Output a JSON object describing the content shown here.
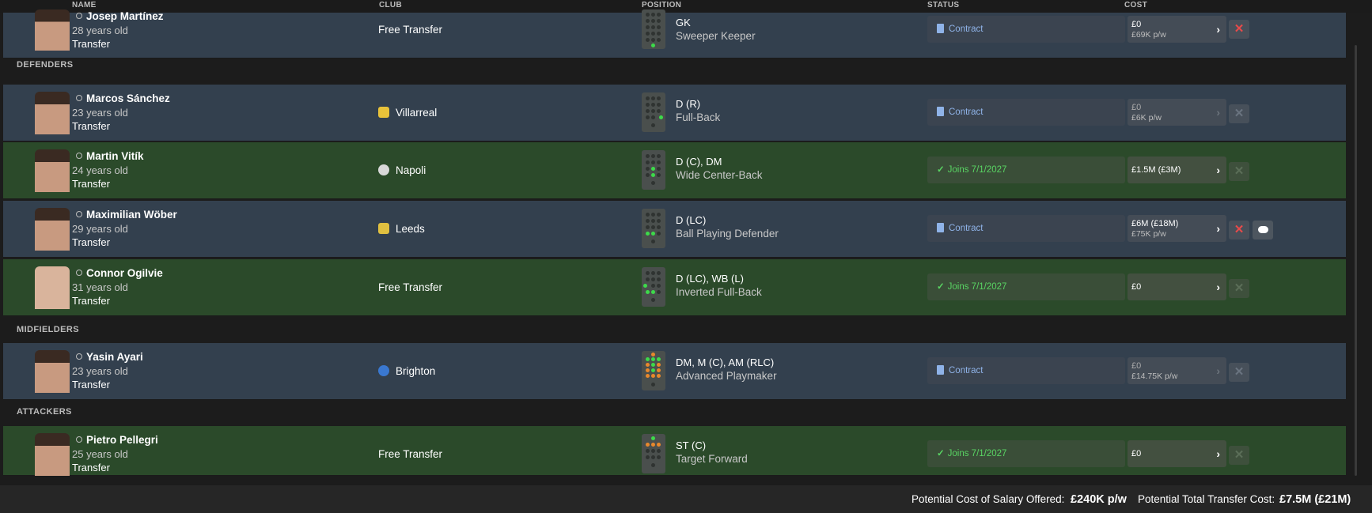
{
  "columns": {
    "name": "NAME",
    "club": "CLUB",
    "position": "POSITION",
    "status": "STATUS",
    "cost": "COST"
  },
  "sections": {
    "defenders": "DEFENDERS",
    "midfielders": "MIDFIELDERS",
    "attackers": "ATTACKERS"
  },
  "players": [
    {
      "name": "Josep Martínez",
      "age": "28 years old",
      "transfer": "Transfer",
      "club": "Free Transfer",
      "club_icon": "",
      "pos1": "GK",
      "pos2": "Sweeper Keeper",
      "status": "Contract",
      "status_type": "contract",
      "cost1": "£0",
      "cost2": "£69K p/w",
      "cancel_active": true,
      "chat": false
    },
    {
      "name": "Marcos Sánchez",
      "age": "23 years old",
      "transfer": "Transfer",
      "club": "Villarreal",
      "club_icon": "villarreal-badge-icon",
      "pos1": "D (R)",
      "pos2": "Full-Back",
      "status": "Contract",
      "status_type": "contract",
      "cost1": "£0",
      "cost2": "£6K p/w",
      "cancel_active": false,
      "chat": false
    },
    {
      "name": "Martin Vitík",
      "age": "24 years old",
      "transfer": "Transfer",
      "club": "Napoli",
      "club_icon": "napoli-badge-icon",
      "pos1": "D (C), DM",
      "pos2": "Wide Center-Back",
      "status": "Joins 7/1/2027",
      "status_type": "joins",
      "cost1": "£1.5M (£3M)",
      "cost2": "",
      "cancel_active": false,
      "chat": false
    },
    {
      "name": "Maximilian Wöber",
      "age": "29 years old",
      "transfer": "Transfer",
      "club": "Leeds",
      "club_icon": "leeds-badge-icon",
      "pos1": "D (LC)",
      "pos2": "Ball Playing Defender",
      "status": "Contract",
      "status_type": "contract",
      "cost1": "£6M (£18M)",
      "cost2": "£75K p/w",
      "cancel_active": true,
      "chat": true
    },
    {
      "name": "Connor Ogilvie",
      "age": "31 years old",
      "transfer": "Transfer",
      "club": "Free Transfer",
      "club_icon": "",
      "pos1": "D (LC), WB (L)",
      "pos2": "Inverted Full-Back",
      "status": "Joins 7/1/2027",
      "status_type": "joins",
      "cost1": "£0",
      "cost2": "",
      "cancel_active": false,
      "chat": false
    },
    {
      "name": "Yasin Ayari",
      "age": "23 years old",
      "transfer": "Transfer",
      "club": "Brighton",
      "club_icon": "brighton-badge-icon",
      "pos1": "DM, M (C), AM (RLC)",
      "pos2": "Advanced Playmaker",
      "status": "Contract",
      "status_type": "contract",
      "cost1": "£0",
      "cost2": "£14.75K p/w",
      "cancel_active": false,
      "chat": false
    },
    {
      "name": "Pietro Pellegri",
      "age": "25 years old",
      "transfer": "Transfer",
      "club": "Free Transfer",
      "club_icon": "",
      "pos1": "ST (C)",
      "pos2": "Target Forward",
      "status": "Joins 7/1/2027",
      "status_type": "joins",
      "cost1": "£0",
      "cost2": "",
      "cancel_active": false,
      "chat": false
    }
  ],
  "footer": {
    "salary_label": "Potential Cost of Salary Offered:",
    "salary_value": "£240K p/w",
    "transfer_label": "Potential Total Transfer Cost:",
    "transfer_value": "£7.5M (£21M)"
  },
  "colors": {
    "contract": "#8fb3e8",
    "joins": "#59d463",
    "cancel": "#e84a4a",
    "row_blue": "#33404e",
    "row_green": "#2b4a2a"
  }
}
